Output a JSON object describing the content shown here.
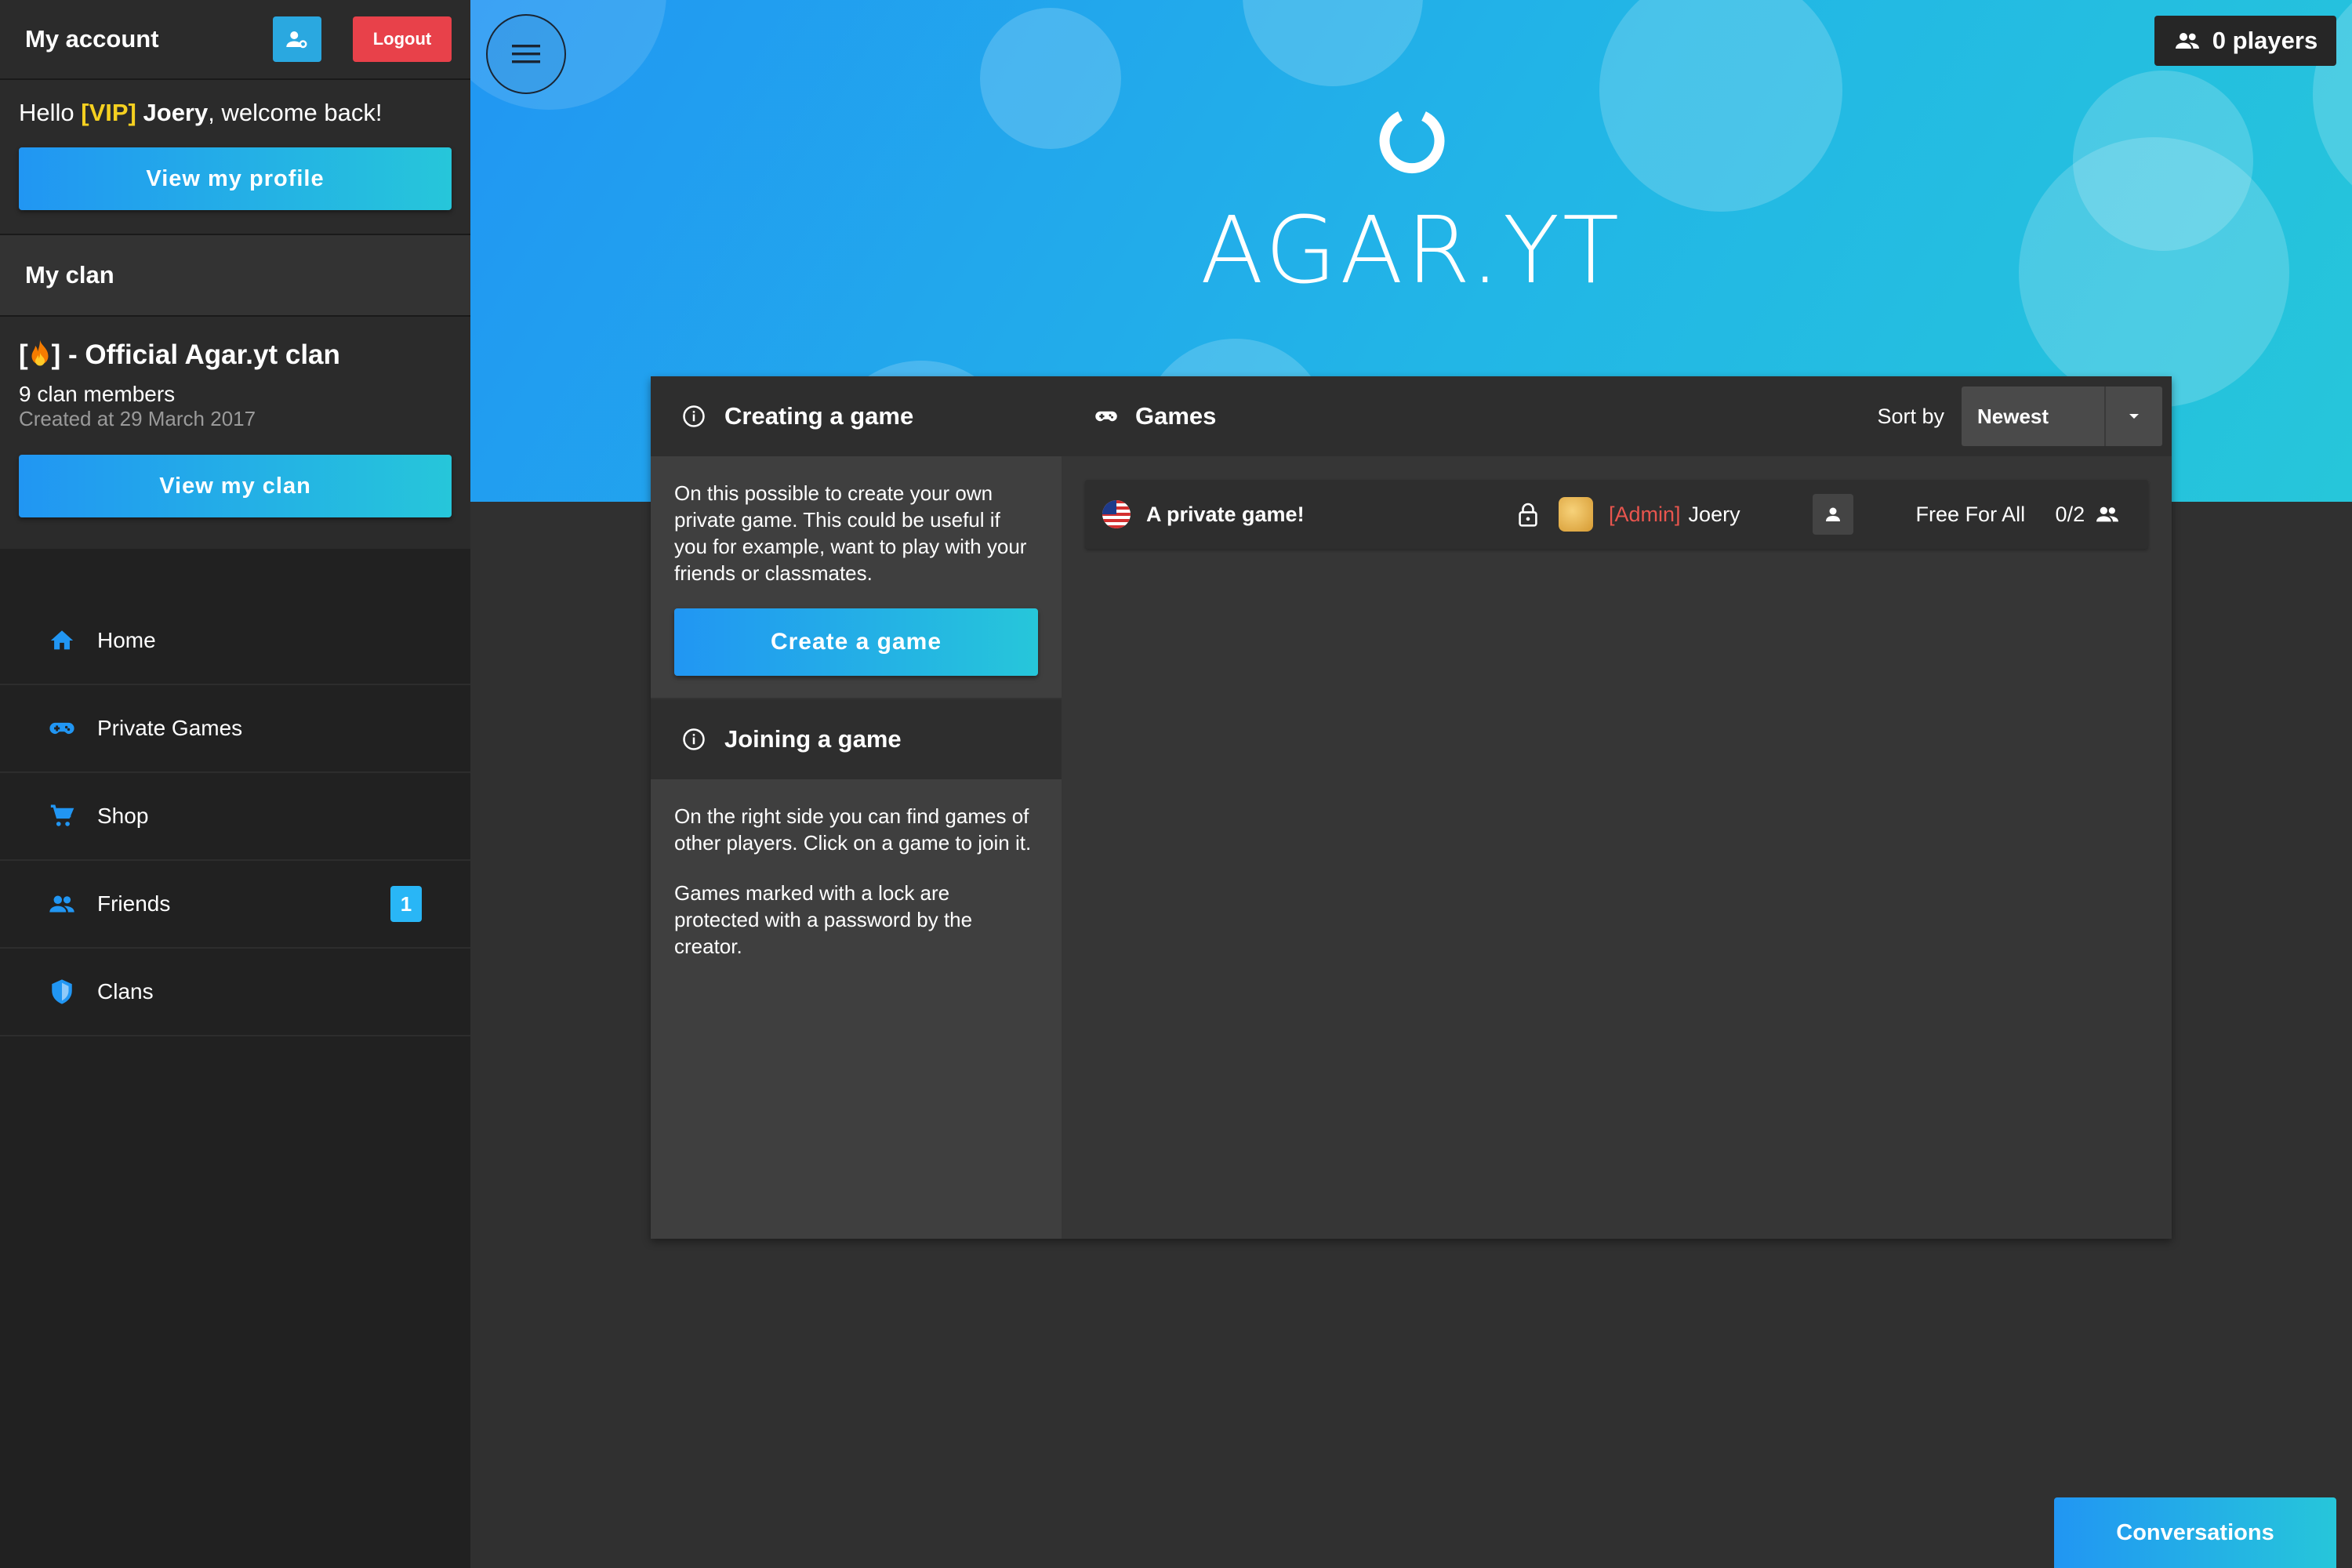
{
  "account": {
    "title": "My account",
    "logout_label": "Logout",
    "hello_prefix": "Hello ",
    "vip_tag": "[VIP]",
    "username": "Joery",
    "hello_suffix": ", welcome back!",
    "view_profile_label": "View my profile"
  },
  "clan": {
    "title": "My clan",
    "name_prefix": "[",
    "name_suffix": "] - Official Agar.yt clan",
    "members": "9 clan members",
    "created": "Created at 29 March 2017",
    "view_clan_label": "View my clan"
  },
  "nav": [
    {
      "label": "Home",
      "icon": "home-icon"
    },
    {
      "label": "Private Games",
      "icon": "gamepad-icon"
    },
    {
      "label": "Shop",
      "icon": "cart-icon"
    },
    {
      "label": "Friends",
      "icon": "friends-icon",
      "badge": "1"
    },
    {
      "label": "Clans",
      "icon": "shield-icon"
    }
  ],
  "hero": {
    "title": "AGAR.YT",
    "players": "0 players"
  },
  "creating": {
    "title": "Creating a game",
    "text": "On this possible to create your own private game. This could be useful if you for example, want to play with your friends or classmates.",
    "button_label": "Create a game"
  },
  "joining": {
    "title": "Joining a game",
    "text1": "On the right side you can find games of other players. Click on a game to join it.",
    "text2": "Games marked with a lock are protected with a password by the creator."
  },
  "games": {
    "title": "Games",
    "sort_label": "Sort by",
    "sort_value": "Newest",
    "rows": [
      {
        "name": "A private game!",
        "admin_tag": "[Admin]",
        "owner": "Joery",
        "mode": "Free For All",
        "count": "0/2"
      }
    ]
  },
  "conversations_label": "Conversations",
  "colors": {
    "accent_start": "#2196f3",
    "accent_end": "#26c6da",
    "logout": "#e8414a",
    "vip": "#f5d020",
    "admin": "#e8554e"
  }
}
